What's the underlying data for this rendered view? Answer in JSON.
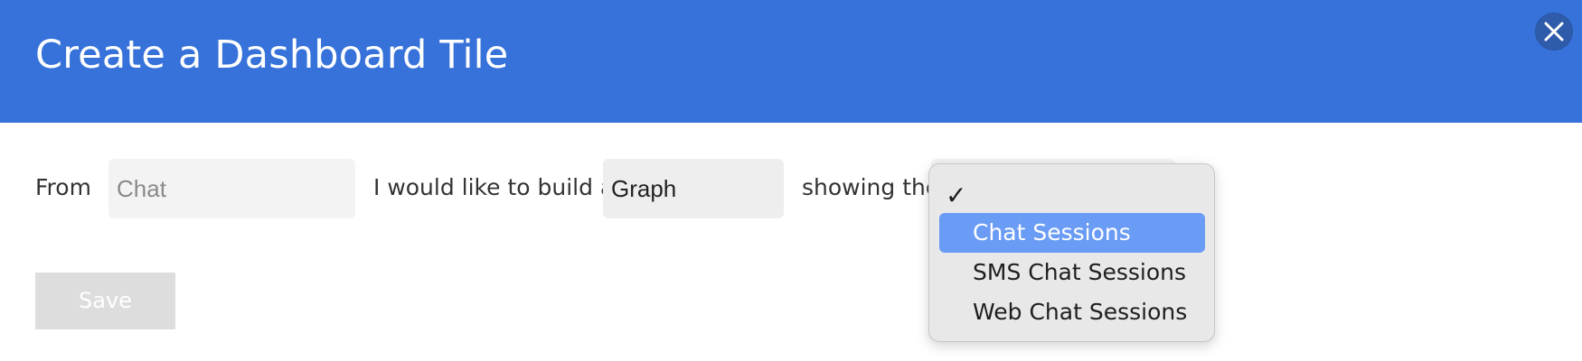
{
  "header": {
    "title": "Create a Dashboard Tile",
    "close_icon": "close-icon",
    "background_color": "#3672d9"
  },
  "form": {
    "from_label": "From",
    "source_value": "Chat",
    "build_label": "I would like to build a",
    "tile_type_value": "Graph",
    "showing_label": "showing the"
  },
  "dropdown": {
    "check_mark": "✓",
    "options": [
      {
        "label": "Chat Sessions",
        "highlighted": true
      },
      {
        "label": "SMS Chat Sessions",
        "highlighted": false
      },
      {
        "label": "Web Chat Sessions",
        "highlighted": false
      }
    ],
    "highlight_color": "#6a9bf5"
  },
  "actions": {
    "save_label": "Save"
  }
}
